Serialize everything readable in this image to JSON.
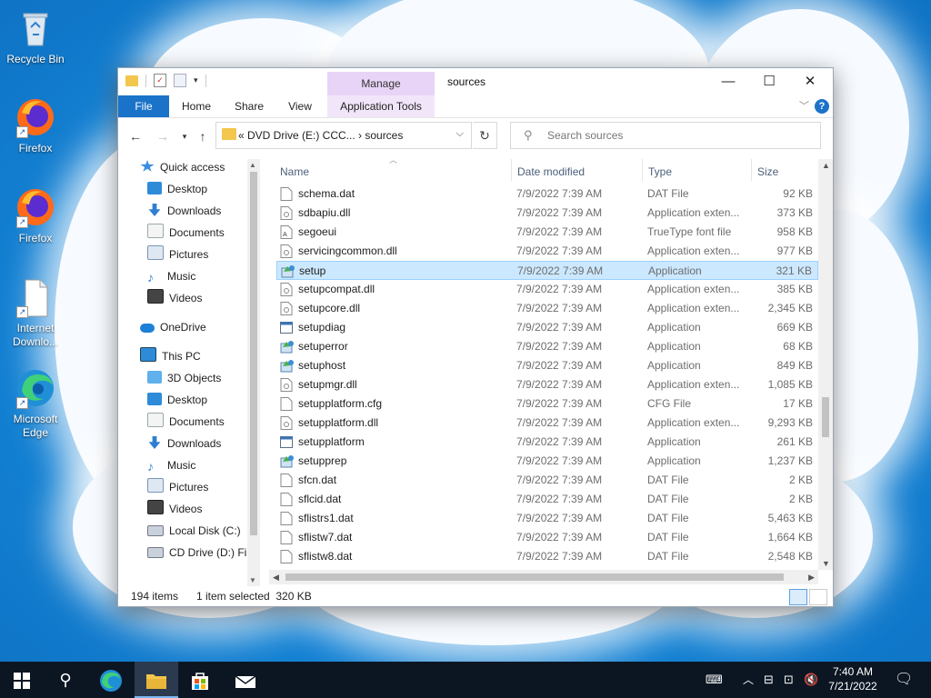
{
  "desktop": {
    "icons": [
      {
        "label": "Recycle Bin",
        "icon": "recycle-bin-icon"
      },
      {
        "label": "Firefox",
        "icon": "firefox-icon"
      },
      {
        "label": "Firefox",
        "icon": "firefox-icon"
      },
      {
        "label": "Internet Downlo...",
        "icon": "file-icon"
      },
      {
        "label": "Microsoft Edge",
        "icon": "edge-icon"
      }
    ]
  },
  "window": {
    "title": "sources",
    "manage_tab": "Manage",
    "ribbon_tabs": [
      "File",
      "Home",
      "Share",
      "View",
      "Application Tools"
    ],
    "address_path": "«  DVD Drive (E:) CCC...  ›  sources",
    "search_placeholder": "Search sources",
    "accent": "#1a73c9"
  },
  "nav_pane": {
    "items": [
      {
        "label": "Quick access",
        "icon": "star-icon"
      },
      {
        "label": "Desktop",
        "icon": "desktop-icon",
        "pinned": true
      },
      {
        "label": "Downloads",
        "icon": "download-icon",
        "pinned": true
      },
      {
        "label": "Documents",
        "icon": "documents-icon",
        "pinned": true
      },
      {
        "label": "Pictures",
        "icon": "pictures-icon",
        "pinned": true
      },
      {
        "label": "Music",
        "icon": "music-icon"
      },
      {
        "label": "Videos",
        "icon": "videos-icon"
      },
      {
        "label": "OneDrive",
        "icon": "cloud-icon"
      },
      {
        "label": "This PC",
        "icon": "computer-icon"
      },
      {
        "label": "3D Objects",
        "icon": "cube-icon"
      },
      {
        "label": "Desktop",
        "icon": "desktop-icon"
      },
      {
        "label": "Documents",
        "icon": "documents-icon"
      },
      {
        "label": "Downloads",
        "icon": "download-icon"
      },
      {
        "label": "Music",
        "icon": "music-icon"
      },
      {
        "label": "Pictures",
        "icon": "pictures-icon"
      },
      {
        "label": "Videos",
        "icon": "videos-icon"
      },
      {
        "label": "Local Disk (C:)",
        "icon": "disk-icon"
      },
      {
        "label": "CD Drive (D:) Fir",
        "icon": "cd-drive-icon"
      }
    ]
  },
  "file_list": {
    "columns": [
      "Name",
      "Date modified",
      "Type",
      "Size"
    ],
    "rows": [
      {
        "name": "schema.dat",
        "date": "7/9/2022 7:39 AM",
        "type": "DAT File",
        "size": "92 KB",
        "icon": "file-icon"
      },
      {
        "name": "sdbapiu.dll",
        "date": "7/9/2022 7:39 AM",
        "type": "Application exten...",
        "size": "373 KB",
        "icon": "dll-icon"
      },
      {
        "name": "segoeui",
        "date": "7/9/2022 7:39 AM",
        "type": "TrueType font file",
        "size": "958 KB",
        "icon": "font-icon"
      },
      {
        "name": "servicingcommon.dll",
        "date": "7/9/2022 7:39 AM",
        "type": "Application exten...",
        "size": "977 KB",
        "icon": "dll-icon"
      },
      {
        "name": "setup",
        "date": "7/9/2022 7:39 AM",
        "type": "Application",
        "size": "321 KB",
        "icon": "setup-icon",
        "selected": true
      },
      {
        "name": "setupcompat.dll",
        "date": "7/9/2022 7:39 AM",
        "type": "Application exten...",
        "size": "385 KB",
        "icon": "dll-icon"
      },
      {
        "name": "setupcore.dll",
        "date": "7/9/2022 7:39 AM",
        "type": "Application exten...",
        "size": "2,345 KB",
        "icon": "dll-icon"
      },
      {
        "name": "setupdiag",
        "date": "7/9/2022 7:39 AM",
        "type": "Application",
        "size": "669 KB",
        "icon": "app-icon"
      },
      {
        "name": "setuperror",
        "date": "7/9/2022 7:39 AM",
        "type": "Application",
        "size": "68 KB",
        "icon": "setup-icon"
      },
      {
        "name": "setuphost",
        "date": "7/9/2022 7:39 AM",
        "type": "Application",
        "size": "849 KB",
        "icon": "setup-icon"
      },
      {
        "name": "setupmgr.dll",
        "date": "7/9/2022 7:39 AM",
        "type": "Application exten...",
        "size": "1,085 KB",
        "icon": "dll-icon"
      },
      {
        "name": "setupplatform.cfg",
        "date": "7/9/2022 7:39 AM",
        "type": "CFG File",
        "size": "17 KB",
        "icon": "file-icon"
      },
      {
        "name": "setupplatform.dll",
        "date": "7/9/2022 7:39 AM",
        "type": "Application exten...",
        "size": "9,293 KB",
        "icon": "dll-icon"
      },
      {
        "name": "setupplatform",
        "date": "7/9/2022 7:39 AM",
        "type": "Application",
        "size": "261 KB",
        "icon": "app-icon"
      },
      {
        "name": "setupprep",
        "date": "7/9/2022 7:39 AM",
        "type": "Application",
        "size": "1,237 KB",
        "icon": "setup-icon"
      },
      {
        "name": "sfcn.dat",
        "date": "7/9/2022 7:39 AM",
        "type": "DAT File",
        "size": "2 KB",
        "icon": "file-icon"
      },
      {
        "name": "sflcid.dat",
        "date": "7/9/2022 7:39 AM",
        "type": "DAT File",
        "size": "2 KB",
        "icon": "file-icon"
      },
      {
        "name": "sflistrs1.dat",
        "date": "7/9/2022 7:39 AM",
        "type": "DAT File",
        "size": "5,463 KB",
        "icon": "file-icon"
      },
      {
        "name": "sflistw7.dat",
        "date": "7/9/2022 7:39 AM",
        "type": "DAT File",
        "size": "1,664 KB",
        "icon": "file-icon"
      },
      {
        "name": "sflistw8.dat",
        "date": "7/9/2022 7:39 AM",
        "type": "DAT File",
        "size": "2,548 KB",
        "icon": "file-icon"
      }
    ]
  },
  "status": {
    "item_count": "194 items",
    "selection": "1 item selected  320 KB"
  },
  "taskbar": {
    "time": "7:40 AM",
    "date": "7/21/2022"
  }
}
